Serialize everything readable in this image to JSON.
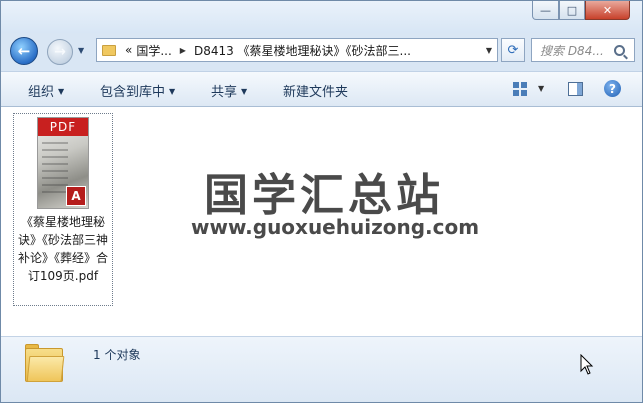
{
  "window": {
    "controls": {
      "minimize": "—",
      "maximize": "□",
      "close": "✕"
    }
  },
  "nav": {
    "back_icon": "←",
    "forward_icon": "→",
    "history_dropdown": "▼",
    "address": {
      "crumbs": [
        "«",
        "国学...",
        "D8413 《蔡星楼地理秘诀》《砂法部三..."
      ],
      "separator": "▶",
      "dropdown": "▼"
    },
    "refresh_icon": "⟳",
    "search_placeholder": "搜索 D84..."
  },
  "toolbar": {
    "organize": "组织",
    "include_library": "包含到库中",
    "share": "共享",
    "new_folder": "新建文件夹",
    "arrow": "▼",
    "help": "?"
  },
  "content": {
    "file": {
      "thumb_label": "PDF",
      "badge": "A",
      "name": "《蔡星楼地理秘诀》《砂法部三神补论》《葬经》合订109页.pdf"
    },
    "watermark": {
      "title": "国学汇总站",
      "url": "www.guoxuehuizong.com"
    }
  },
  "status": {
    "count_text": "1 个对象"
  },
  "colors": {
    "accent": "#1e395b",
    "close_button": "#c8412b",
    "pdf_red": "#c8201f",
    "folder_yellow": "#efc55a"
  }
}
